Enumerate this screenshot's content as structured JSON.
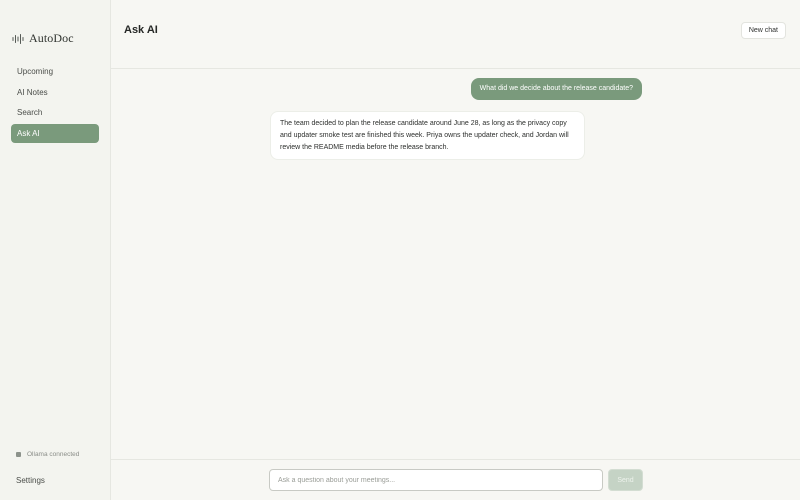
{
  "app": {
    "name": "AutoDoc",
    "logo_icon": "waveform-icon"
  },
  "sidebar": {
    "items": [
      {
        "label": "Upcoming"
      },
      {
        "label": "AI Notes"
      },
      {
        "label": "Search"
      },
      {
        "label": "Ask AI",
        "active": true
      }
    ],
    "status": "Ollama connected",
    "settings_label": "Settings"
  },
  "header": {
    "title": "Ask AI",
    "new_chat_label": "New chat"
  },
  "conversation": {
    "messages": [
      {
        "role": "user",
        "text": "What did we decide about the release candidate?"
      },
      {
        "role": "assistant",
        "text": "The team decided to plan the release candidate around June 28, as long as the privacy copy and updater smoke test are finished this week. Priya owns the updater check, and Jordan will review the README media before the release branch."
      }
    ]
  },
  "composer": {
    "placeholder": "Ask a question about your meetings...",
    "value": "",
    "send_label": "Send"
  },
  "colors": {
    "accent": "#7a9a7c",
    "accent_disabled": "#c5d3c5",
    "background": "#f7f7f3",
    "sidebar_bg": "#f3f4ef"
  }
}
